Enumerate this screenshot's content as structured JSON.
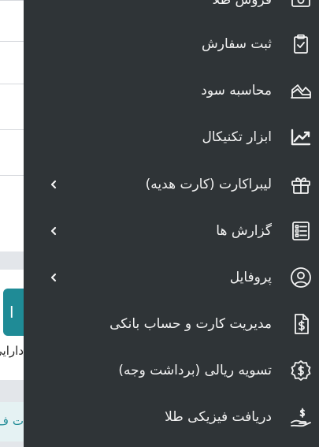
{
  "background_page": {
    "fragment_1": "دارایی",
    "fragment_2": "ت ف"
  },
  "drawer": {
    "items": [
      {
        "label": "فروش طلا",
        "icon": "cash-icon"
      },
      {
        "label": "ثبت سفارش",
        "icon": "clipboard-check-icon"
      },
      {
        "label": "محاسبه سود",
        "icon": "area-chart-icon"
      },
      {
        "label": "ابزار تکنیکال",
        "icon": "trending-up-icon"
      },
      {
        "label": "لیبراکارت (کارت هدیه)",
        "icon": "gift-icon"
      },
      {
        "label": "گزارش ها",
        "icon": "list-report-icon"
      },
      {
        "label": "پروفایل",
        "icon": "user-circle-icon"
      },
      {
        "label": "مدیریت کارت و حساب بانکی",
        "icon": "dollar-document-icon"
      },
      {
        "label": "تسویه ریالی (برداشت وجه)",
        "icon": "dollar-badge-icon"
      },
      {
        "label": "دریافت فیزیکی طلا",
        "icon": "hand-coin-icon"
      }
    ]
  },
  "colors": {
    "drawer_bg": "#2f3437",
    "text": "#f2f2f2",
    "accent": "#1f8b96"
  }
}
